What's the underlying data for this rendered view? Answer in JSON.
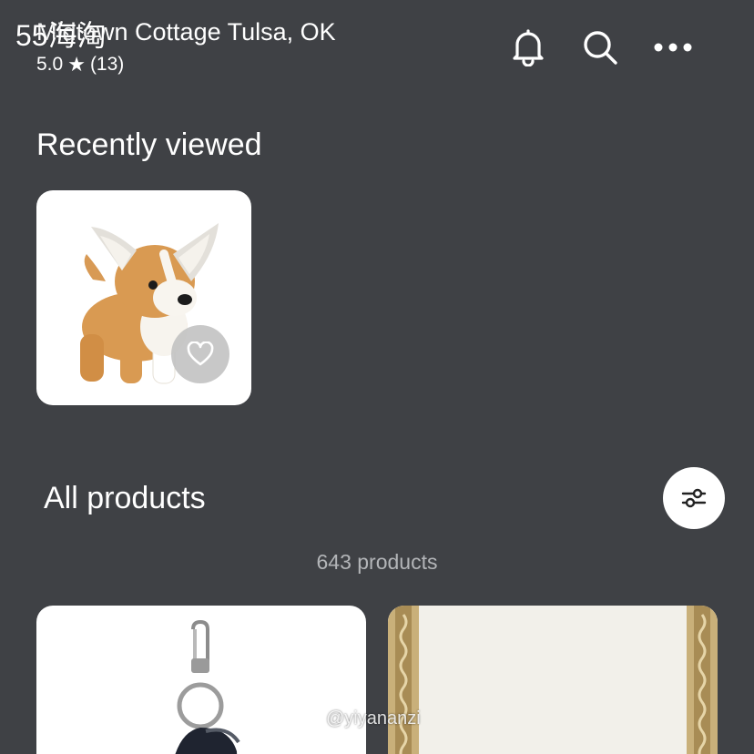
{
  "header": {
    "shop_name": "Midtown Cottage Tulsa, OK",
    "app_badge": "55海淘",
    "rating_value": "5.0",
    "rating_count": "(13)",
    "icons": [
      "bell-icon",
      "search-icon",
      "more-icon"
    ]
  },
  "recently_viewed": {
    "title": "Recently viewed",
    "items": [
      {
        "image": "plush-corgi-toy",
        "favorite_icon": "heart-outline-icon"
      }
    ]
  },
  "all_products": {
    "title": "All products",
    "count_text": "643 products",
    "filter_icon": "sliders-icon",
    "items": [
      {
        "image": "keychain-product"
      },
      {
        "image": "framed-mirror-product"
      }
    ]
  },
  "watermark": "@yiyananzi",
  "colors": {
    "background": "#3f4145",
    "card": "#ffffff",
    "muted_text": "#b3b5b8"
  }
}
